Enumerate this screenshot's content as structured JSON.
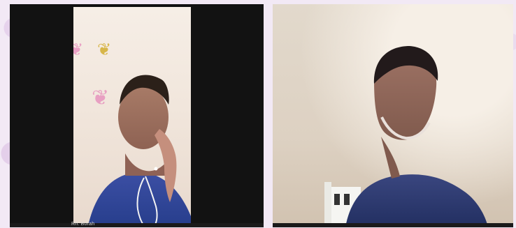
{
  "meeting": {
    "participants": [
      {
        "name": "Rh. Borah",
        "name_color": "#d7d7d7",
        "tile_color": "#121212"
      },
      {
        "name": "",
        "name_color": "#ffffff",
        "tile_color": "#d9cfc2"
      }
    ],
    "background_color": "#f2e9f5"
  }
}
